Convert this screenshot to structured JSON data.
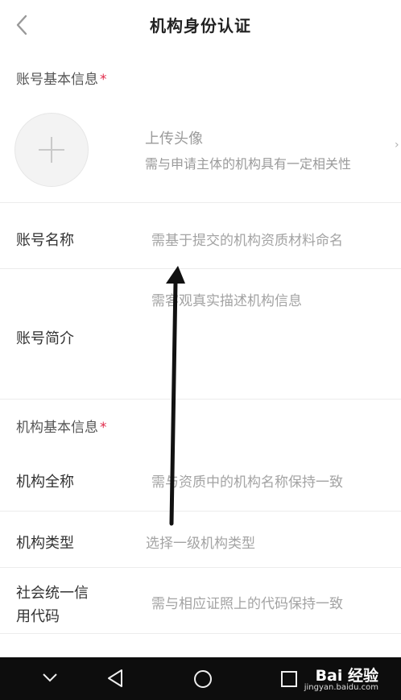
{
  "header": {
    "title": "机构身份认证",
    "back_icon": "chevron-left-icon"
  },
  "account_basic": {
    "section_title": "账号基本信息",
    "required_mark": "*",
    "avatar": {
      "icon": "plus-icon",
      "label": "上传头像",
      "hint": "需与申请主体的机构具有一定相关性"
    },
    "name": {
      "label": "账号名称",
      "placeholder": "需基于提交的机构资质材料命名"
    },
    "intro": {
      "label": "账号简介",
      "placeholder": "需客观真实描述机构信息"
    }
  },
  "org_basic": {
    "section_title": "机构基本信息",
    "required_mark": "*",
    "full_name": {
      "label": "机构全称",
      "placeholder": "需与资质中的机构名称保持一致"
    },
    "type": {
      "label": "机构类型",
      "placeholder": "选择一级机构类型"
    },
    "credit_code": {
      "label_line1": "社会统一信",
      "label_line2": "用代码",
      "placeholder": "需与相应证照上的代码保持一致"
    }
  },
  "navbar": {
    "icons": [
      "chevron-down-icon",
      "back-triangle-icon",
      "home-circle-icon",
      "recent-square-icon"
    ],
    "watermark": "Bai 经验",
    "watermark_sub": "jingyan.baidu.com"
  },
  "colors": {
    "required": "#e02a4a",
    "placeholder": "#a3a3a3",
    "navbar": "#0d0d0d"
  }
}
